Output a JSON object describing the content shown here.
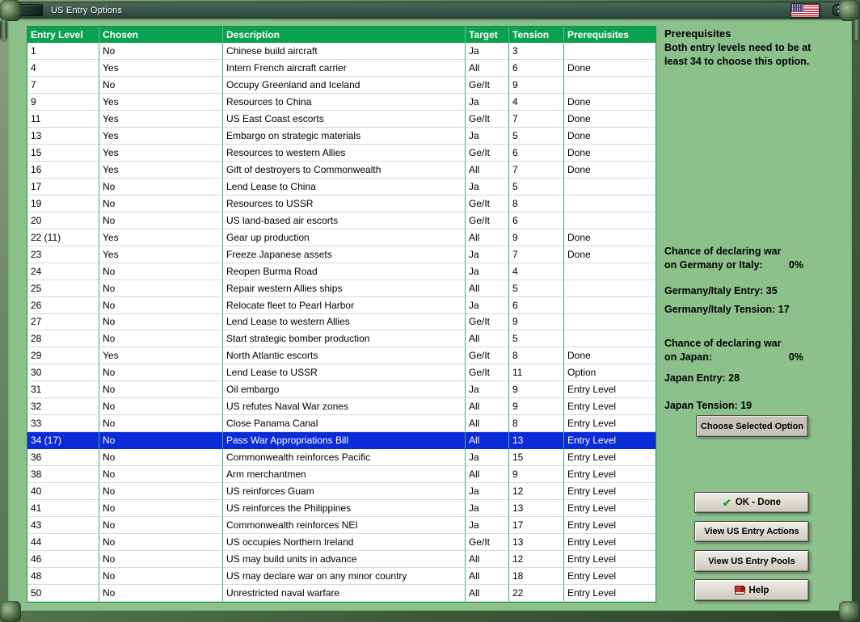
{
  "window": {
    "title": "US Entry Options",
    "close_label": "X"
  },
  "table": {
    "columns": [
      "Entry Level",
      "Chosen",
      "Description",
      "Target",
      "Tension",
      "Prerequisites"
    ],
    "selected_index": 23,
    "rows": [
      [
        "1",
        "No",
        "Chinese build aircraft",
        "Ja",
        "3",
        ""
      ],
      [
        "4",
        "Yes",
        "Intern French aircraft carrier",
        "All",
        "6",
        "Done"
      ],
      [
        "7",
        "No",
        "Occupy Greenland and Iceland",
        "Ge/It",
        "9",
        ""
      ],
      [
        "9",
        "Yes",
        "Resources to China",
        "Ja",
        "4",
        "Done"
      ],
      [
        "11",
        "Yes",
        "US East Coast escorts",
        "Ge/It",
        "7",
        "Done"
      ],
      [
        "13",
        "Yes",
        "Embargo on strategic materials",
        "Ja",
        "5",
        "Done"
      ],
      [
        "15",
        "Yes",
        "Resources to western Allies",
        "Ge/It",
        "6",
        "Done"
      ],
      [
        "16",
        "Yes",
        "Gift of destroyers to Commonwealth",
        "All",
        "7",
        "Done"
      ],
      [
        "17",
        "No",
        "Lend Lease to China",
        "Ja",
        "5",
        ""
      ],
      [
        "19",
        "No",
        "Resources to USSR",
        "Ge/It",
        "8",
        ""
      ],
      [
        "20",
        "No",
        "US land-based air escorts",
        "Ge/It",
        "6",
        ""
      ],
      [
        "22 (11)",
        "Yes",
        "Gear up production",
        "All",
        "9",
        "Done"
      ],
      [
        "23",
        "Yes",
        "Freeze Japanese assets",
        "Ja",
        "7",
        "Done"
      ],
      [
        "24",
        "No",
        "Reopen Burma Road",
        "Ja",
        "4",
        ""
      ],
      [
        "25",
        "No",
        "Repair western Allies ships",
        "All",
        "5",
        ""
      ],
      [
        "26",
        "No",
        "Relocate fleet to Pearl Harbor",
        "Ja",
        "6",
        ""
      ],
      [
        "27",
        "No",
        "Lend Lease to western Allies",
        "Ge/It",
        "9",
        ""
      ],
      [
        "28",
        "No",
        "Start strategic bomber production",
        "All",
        "5",
        ""
      ],
      [
        "29",
        "Yes",
        "North Atlantic escorts",
        "Ge/It",
        "8",
        "Done"
      ],
      [
        "30",
        "No",
        "Lend Lease to USSR",
        "Ge/It",
        "11",
        "Option"
      ],
      [
        "31",
        "No",
        "Oil embargo",
        "Ja",
        "9",
        "Entry Level"
      ],
      [
        "32",
        "No",
        "US refutes Naval War zones",
        "All",
        "9",
        "Entry Level"
      ],
      [
        "33",
        "No",
        "Close Panama Canal",
        "All",
        "8",
        "Entry Level"
      ],
      [
        "34 (17)",
        "No",
        "Pass War Appropriations Bill",
        "All",
        "13",
        "Entry Level"
      ],
      [
        "36",
        "No",
        "Commonwealth reinforces Pacific",
        "Ja",
        "15",
        "Entry Level"
      ],
      [
        "38",
        "No",
        "Arm merchantmen",
        "All",
        "9",
        "Entry Level"
      ],
      [
        "40",
        "No",
        "US reinforces Guam",
        "Ja",
        "12",
        "Entry Level"
      ],
      [
        "41",
        "No",
        "US reinforces the Philippines",
        "Ja",
        "13",
        "Entry Level"
      ],
      [
        "43",
        "No",
        "Commonwealth reinforces NEI",
        "Ja",
        "17",
        "Entry Level"
      ],
      [
        "44",
        "No",
        "US occupies Northern Ireland",
        "Ge/It",
        "13",
        "Entry Level"
      ],
      [
        "46",
        "No",
        "US may build units in advance",
        "All",
        "12",
        "Entry Level"
      ],
      [
        "48",
        "No",
        "US may declare war on any minor country",
        "All",
        "18",
        "Entry Level"
      ],
      [
        "50",
        "No",
        "Unrestricted naval warfare",
        "All",
        "22",
        "Entry Level"
      ]
    ]
  },
  "sidebar": {
    "prerequisites_title": "Prerequisites",
    "prerequisites_text": "Both entry levels need to be at least 34 to choose this option.",
    "germany_chance_line1": "Chance of declaring war",
    "germany_chance_line2": "on Germany or Italy:",
    "germany_chance_value": "0%",
    "germany_entry": "Germany/Italy Entry: 35",
    "germany_tension": "Germany/Italy Tension: 17",
    "japan_chance_line1": "Chance of declaring war",
    "japan_chance_line2": "on Japan:",
    "japan_chance_value": "0%",
    "japan_entry": "Japan Entry: 28",
    "japan_tension": "Japan Tension: 19"
  },
  "buttons": {
    "choose": "Choose Selected Option",
    "ok": "OK - Done",
    "view_actions": "View US Entry Actions",
    "view_pools": "View US Entry Pools",
    "help": "Help"
  },
  "colors": {
    "content_background": "#8cc18c",
    "table_header_green": "#0ba14f",
    "selection_blue": "#0b2bd8",
    "titlebar_green": "#3a564c"
  }
}
